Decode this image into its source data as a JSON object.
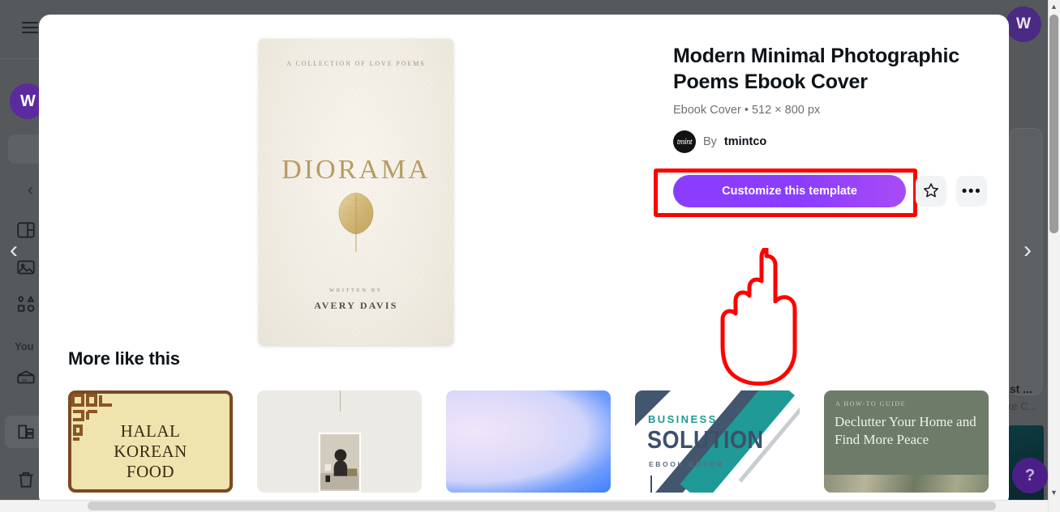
{
  "background": {
    "rail_label": "You",
    "avatar_initial": "W",
    "chevron_left": "‹",
    "chevron_right": "›",
    "small_chevron": "‹",
    "close_avatar_initial": "W",
    "right_text_title": "ist ...",
    "right_text_sub": "ke C...",
    "help_label": "?",
    "icons": [
      {
        "name": "layout-panel-icon"
      },
      {
        "name": "image-icon"
      },
      {
        "name": "shapes-icon"
      },
      {
        "name": "folder-icon"
      },
      {
        "name": "apps-icon"
      },
      {
        "name": "trash-icon"
      }
    ]
  },
  "modal": {
    "close_label": "×",
    "cover": {
      "kicker": "A COLLECTION OF LOVE POEMS",
      "title": "DIORAMA",
      "written_by": "WRITTEN BY",
      "author": "AVERY DAVIS"
    },
    "info": {
      "title": "Modern Minimal Photographic Poems Ebook Cover",
      "meta": "Ebook Cover • 512 × 800 px",
      "by_label": "By",
      "author_name": "tmintco",
      "avatar_text": "tmint"
    },
    "actions": {
      "primary_label": "Customize this template",
      "primary_color": "#8b3dff",
      "star_icon": "star-icon",
      "more_icon": "more-options-icon",
      "more_label": "•••",
      "highlight_color": "#ff0000"
    },
    "more_like_this": {
      "heading": "More like this",
      "items": [
        {
          "name": "halal-korean-food",
          "line1": "HALAL",
          "line2": "KOREAN",
          "line3": "FOOD"
        },
        {
          "name": "photo-frame-cover",
          "line1": "",
          "line2": "",
          "line3": ""
        },
        {
          "name": "watercolor-blue-cover",
          "line1": "",
          "line2": "",
          "line3": ""
        },
        {
          "name": "business-solution-cover",
          "line1": "BUSINESS",
          "line2": "SOLUTION",
          "line3": "EBOOK COVER"
        },
        {
          "name": "declutter-your-home-cover",
          "line1": "A HOW-TO GUIDE",
          "line2": "Declutter Your Home and Find More Peace",
          "line3": ""
        }
      ]
    }
  }
}
